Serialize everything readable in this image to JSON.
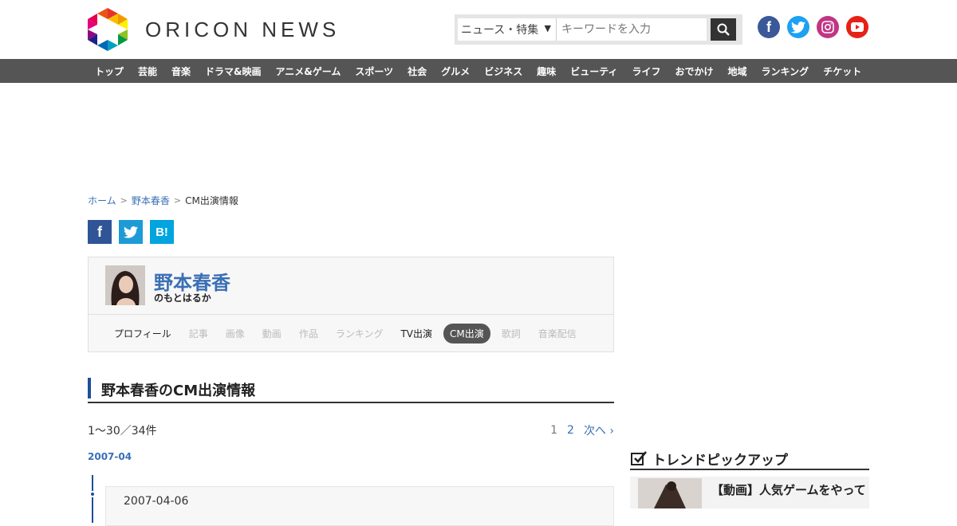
{
  "header": {
    "logo_text": "ORICON NEWS",
    "search": {
      "category": "ニュース・特集",
      "placeholder": "キーワードを入力"
    },
    "social": [
      {
        "name": "facebook-icon",
        "glyph": "f",
        "color": "#3b5998"
      },
      {
        "name": "twitter-icon",
        "glyph": "t",
        "color": "#1da1f2"
      },
      {
        "name": "instagram-icon",
        "glyph": "◎",
        "color": "#c13584"
      },
      {
        "name": "youtube-icon",
        "glyph": "▶",
        "color": "#e62117"
      }
    ]
  },
  "nav": {
    "items": [
      "トップ",
      "芸能",
      "音楽",
      "ドラマ&映画",
      "アニメ&ゲーム",
      "スポーツ",
      "社会",
      "グルメ",
      "ビジネス",
      "趣味",
      "ビューティ",
      "ライフ",
      "おでかけ",
      "地域",
      "ランキング",
      "チケット"
    ]
  },
  "breadcrumb": {
    "home": "ホーム",
    "person": "野本春香",
    "current": "CM出演情報"
  },
  "share": {
    "facebook": "f",
    "twitter": "t",
    "hatena": "B!"
  },
  "profile": {
    "name": "野本春香",
    "kana": "のもとはるか",
    "tabs": [
      {
        "label": "プロフィール",
        "state": "on"
      },
      {
        "label": "記事",
        "state": "off"
      },
      {
        "label": "画像",
        "state": "off"
      },
      {
        "label": "動画",
        "state": "off"
      },
      {
        "label": "作品",
        "state": "off"
      },
      {
        "label": "ランキング",
        "state": "off"
      },
      {
        "label": "TV出演",
        "state": "on"
      },
      {
        "label": "CM出演",
        "state": "active"
      },
      {
        "label": "歌詞",
        "state": "off"
      },
      {
        "label": "音楽配信",
        "state": "off"
      }
    ]
  },
  "section": {
    "title": "野本春香のCM出演情報"
  },
  "listing": {
    "count": "1～30／34件",
    "pages": [
      "1",
      "2"
    ],
    "next": "次へ"
  },
  "timeline": {
    "month": "2007-04",
    "date": "2007-04-06"
  },
  "sidebar": {
    "title": "トレンドピックアップ",
    "item_title": "【動画】人気ゲームをやって"
  },
  "colors": {
    "nav_bg": "#555555",
    "accent_blue": "#3a6fb5",
    "heading_bar": "#1d4f9c"
  }
}
